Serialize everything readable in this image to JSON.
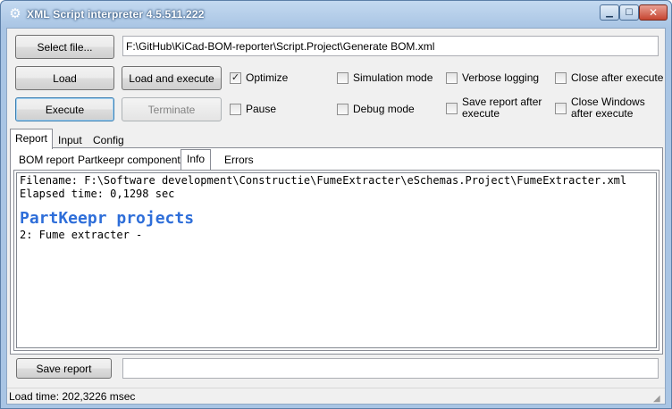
{
  "window": {
    "title": "XML Script interpreter 4.5.511.222",
    "icon": "gear-icon",
    "controls": {
      "minimize": "▁",
      "maximize": "☐",
      "close": "✕"
    }
  },
  "toolbar": {
    "select_file_label": "Select file...",
    "file_path": "F:\\GitHub\\KiCad-BOM-reporter\\Script.Project\\Generate BOM.xml",
    "load_label": "Load",
    "load_execute_label": "Load and execute",
    "execute_label": "Execute",
    "terminate_label": "Terminate"
  },
  "options": {
    "optimize": {
      "label": "Optimize",
      "checked": true
    },
    "pause": {
      "label": "Pause",
      "checked": false
    },
    "simulation": {
      "label": "Simulation mode",
      "checked": false
    },
    "debug": {
      "label": "Debug mode",
      "checked": false
    },
    "verbose": {
      "label": "Verbose logging",
      "checked": false
    },
    "save_report_line1": "Save report after",
    "save_report_line2": "execute",
    "close_after": {
      "label": "Close after execute",
      "checked": false
    },
    "close_windows_line1": "Close Windows",
    "close_windows_line2": "after execute"
  },
  "tabs": {
    "report": "Report",
    "input": "Input",
    "config": "Config"
  },
  "inner_tabs": {
    "bom_report": "BOM report",
    "partkeepr": "Partkeepr components",
    "info": "Info",
    "errors": "Errors"
  },
  "report": {
    "filename_line": "Filename: F:\\Software development\\Constructie\\FumeExtracter\\eSchemas.Project\\FumeExtracter.xml",
    "elapsed_line": "Elapsed time: 0,1298 sec",
    "heading": "PartKeepr projects",
    "project_line": "2: Fume extracter -",
    "heading_color": "#2e6ed9"
  },
  "footer": {
    "save_report_label": "Save report",
    "status_text": "Load time: 202,3226 msec"
  }
}
